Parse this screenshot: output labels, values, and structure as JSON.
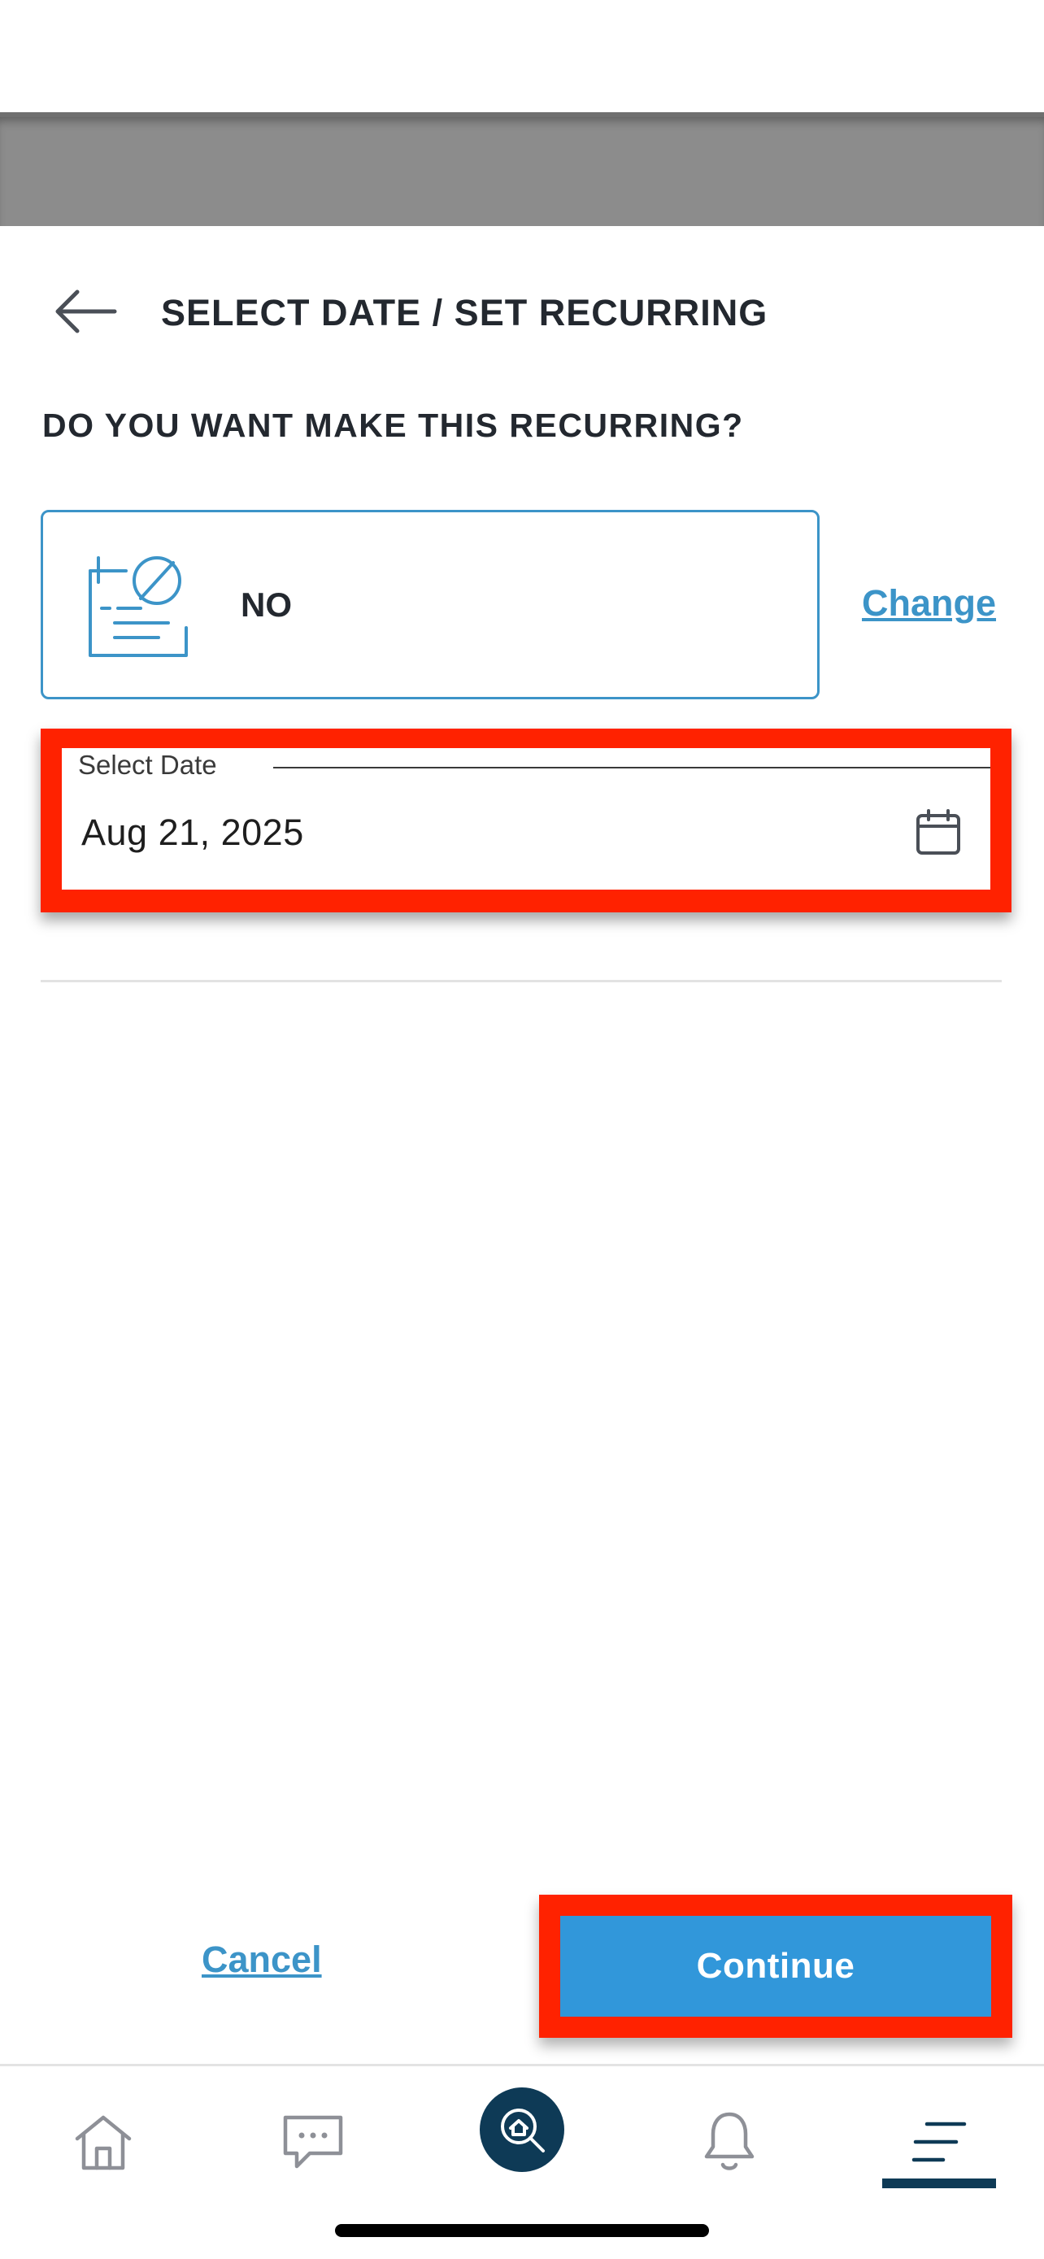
{
  "header": {
    "title": "SELECT DATE / SET RECURRING",
    "back_icon": "arrow-left-icon"
  },
  "recurring": {
    "question": "DO YOU WANT MAKE THIS RECURRING?",
    "value": "NO",
    "icon": "no-recurrence-icon",
    "change_label": "Change"
  },
  "date_field": {
    "label": "Select Date",
    "value": "Aug 21, 2025",
    "icon": "calendar-icon"
  },
  "actions": {
    "cancel_label": "Cancel",
    "continue_label": "Continue"
  },
  "bottom_nav": {
    "items": [
      "home-icon",
      "chat-icon",
      "search-home-icon",
      "bell-icon",
      "menu-icon"
    ],
    "active": "menu-icon"
  },
  "colors": {
    "accent": "#3c94c8",
    "button": "#3197da",
    "nav_dark": "#0e3a56",
    "highlight": "#ff2200",
    "text": "#23282f"
  }
}
